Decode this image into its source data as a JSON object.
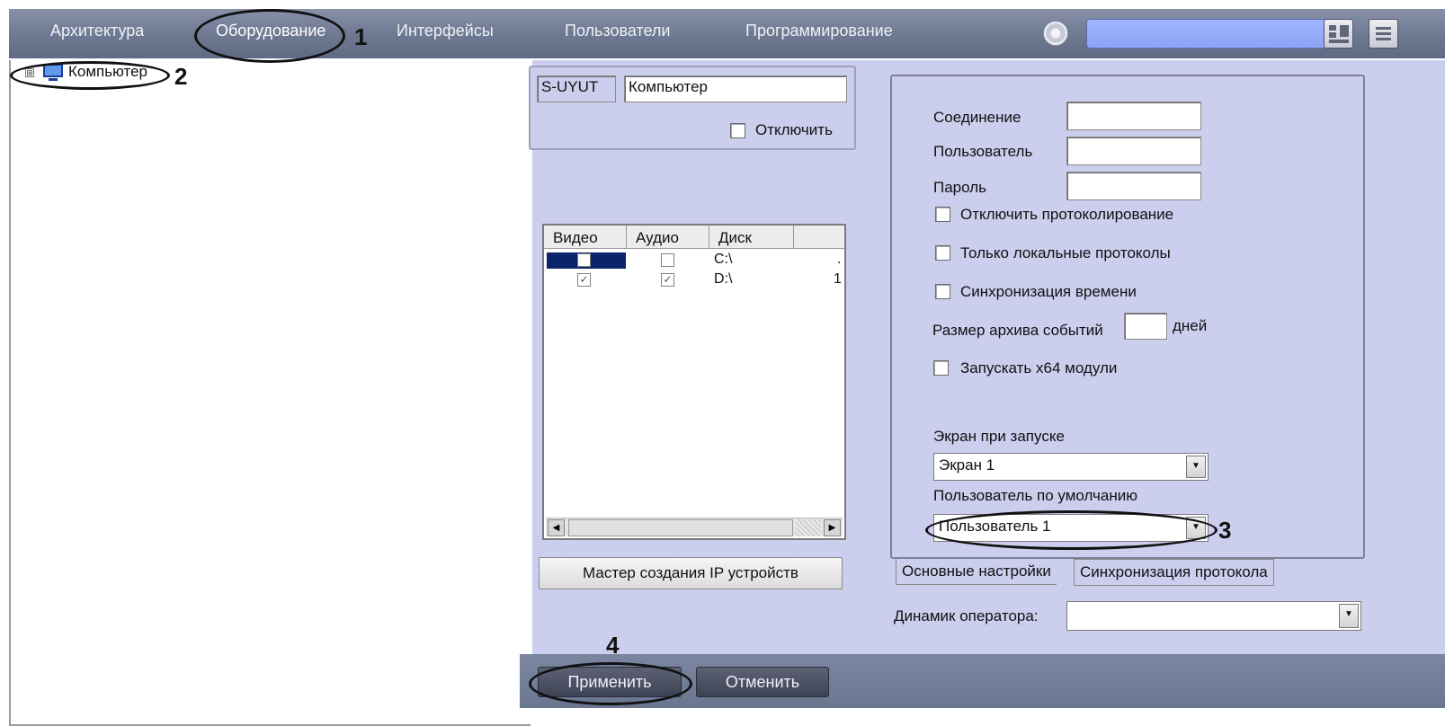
{
  "toolbar": {
    "tabs": [
      "Архитектура",
      "Оборудование",
      "Интерфейсы",
      "Пользователи",
      "Программирование"
    ]
  },
  "tree": {
    "root_label": "Компьютер",
    "expand_glyph": "⊞"
  },
  "object": {
    "id": "S-UYUT",
    "name": "Компьютер",
    "disable_label": "Отключить"
  },
  "disks": {
    "columns": [
      "Видео",
      "Аудио",
      "Диск"
    ],
    "rows": [
      {
        "video": false,
        "audio": false,
        "disk": "C:\\",
        "extra": "."
      },
      {
        "video": true,
        "audio": true,
        "disk": "D:\\",
        "extra": "1"
      }
    ]
  },
  "ip_wizard_button": "Мастер создания IP устройств",
  "settings": {
    "connection_label": "Соединение",
    "connection_value": "",
    "user_label": "Пользователь",
    "user_value": "",
    "password_label": "Пароль",
    "password_value": "",
    "disable_logging_label": "Отключить протоколирование",
    "local_logs_label": "Только локальные протоколы",
    "time_sync_label": "Синхронизация времени",
    "archive_size_label": "Размер архива событий",
    "archive_size_value": "",
    "archive_unit": "дней",
    "x64_modules_label": "Запускать x64 модули",
    "startup_screen_label": "Экран при запуске",
    "startup_screen_value": "Экран 1",
    "default_user_label": "Пользователь по умолчанию",
    "default_user_value": "Пользователь 1"
  },
  "settings_tabs": [
    "Основные настройки",
    "Синхронизация протокола"
  ],
  "operator_speaker": {
    "label": "Динамик оператора:",
    "value": ""
  },
  "bottom": {
    "apply": "Применить",
    "cancel": "Отменить"
  },
  "annotations": [
    "1",
    "2",
    "3",
    "4"
  ]
}
